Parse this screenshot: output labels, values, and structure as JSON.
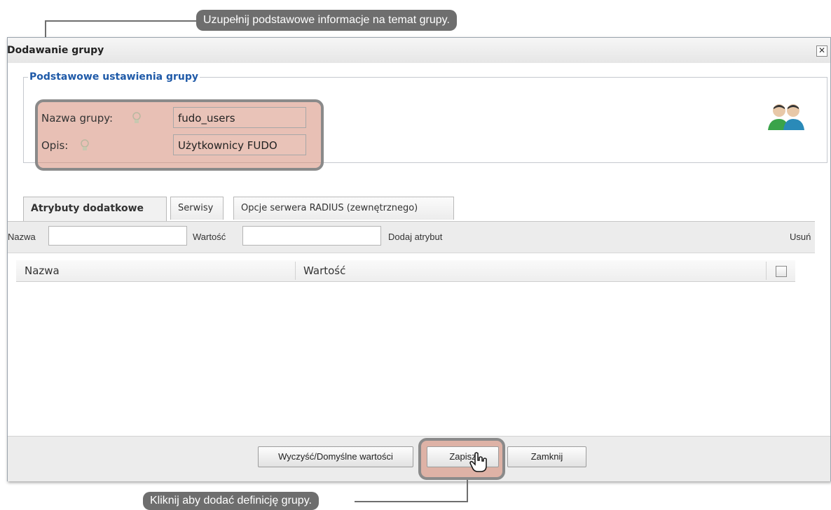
{
  "callouts": {
    "top": "Uzupełnij podstawowe informacje na temat grupy.",
    "bottom": "Kliknij aby dodać definicję grupy."
  },
  "dialog": {
    "title": "Dodawanie grupy",
    "close_label": "✕"
  },
  "basic_settings": {
    "legend": "Podstawowe ustawienia grupy",
    "name_label": "Nazwa grupy:",
    "name_value": "fudo_users",
    "description_label": "Opis:",
    "description_value": "Użytkownicy FUDO"
  },
  "tabs": [
    {
      "label": "Atrybuty dodatkowe",
      "active": true
    },
    {
      "label": "Serwisy",
      "active": false
    },
    {
      "label": "Opcje serwera RADIUS (zewnętrznego)",
      "active": false
    }
  ],
  "attributes": {
    "name_label": "Nazwa",
    "value_label": "Wartość",
    "add_label": "Dodaj atrybut",
    "remove_label": "Usuń",
    "columns": [
      "Nazwa",
      "Wartość"
    ],
    "rows": []
  },
  "buttons": {
    "reset": "Wyczyść/Domyślne wartości",
    "save": "Zapisz",
    "close": "Zamknij"
  },
  "icons": {
    "hint": "lightbulb-icon",
    "users": "users-group-icon",
    "cursor": "hand-pointer-icon"
  },
  "colors": {
    "highlight": "#d68c78",
    "callout": "#6e6e6e",
    "legend": "#1f5aa8"
  }
}
